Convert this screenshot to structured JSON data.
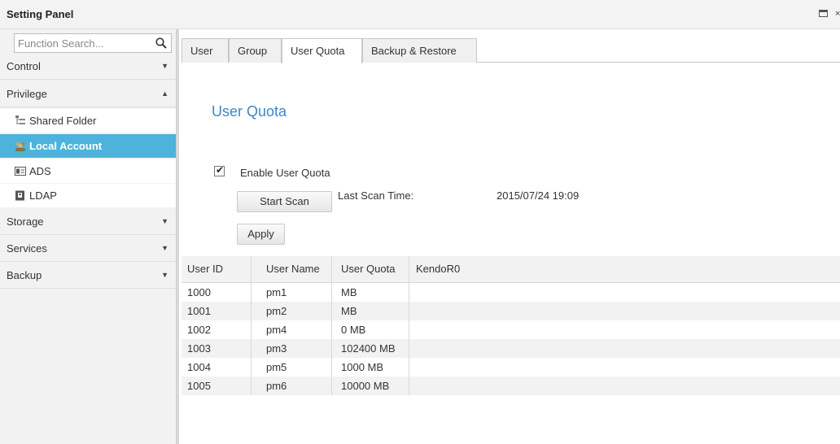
{
  "window": {
    "title": "Setting Panel",
    "close_glyph": "×"
  },
  "search": {
    "placeholder": "Function Search...",
    "icon": "search-icon"
  },
  "sidebar": {
    "groups": [
      {
        "label": "Control",
        "arrow": "▼"
      },
      {
        "label": "Privilege",
        "arrow": "▲"
      },
      {
        "label": "Storage",
        "arrow": "▼"
      },
      {
        "label": "Services",
        "arrow": "▼"
      },
      {
        "label": "Backup",
        "arrow": "▼"
      }
    ],
    "privilege_items": [
      {
        "label": "Shared Folder",
        "icon": "folder-tree-icon"
      },
      {
        "label": "Local Account",
        "icon": "users-icon",
        "active": true
      },
      {
        "label": "ADS",
        "icon": "id-card-icon"
      },
      {
        "label": "LDAP",
        "icon": "directory-icon"
      }
    ],
    "active_color": "#4db3dc"
  },
  "tabs": [
    "User",
    "Group",
    "User Quota",
    "Backup & Restore"
  ],
  "active_tab": "User Quota",
  "main": {
    "section_title": "User Quota",
    "enable_label": "Enable User Quota",
    "enable_checked": true,
    "start_scan_label": "Start Scan",
    "last_scan_label": "Last Scan Time:",
    "last_scan_value": "2015/07/24 19:09",
    "apply_label": "Apply"
  },
  "grid": {
    "columns": [
      "User ID",
      "User Name",
      "User Quota",
      "KendoR0"
    ],
    "rows": [
      [
        "1000",
        "pm1",
        "MB"
      ],
      [
        "1001",
        "pm2",
        "MB"
      ],
      [
        "1002",
        "pm4",
        "0 MB"
      ],
      [
        "1003",
        "pm3",
        "102400 MB"
      ],
      [
        "1004",
        "pm5",
        "1000 MB"
      ],
      [
        "1005",
        "pm6",
        "10000 MB"
      ]
    ]
  },
  "colors": {
    "accent_title": "#3d86c6",
    "selected_nav": "#4db3dc"
  }
}
